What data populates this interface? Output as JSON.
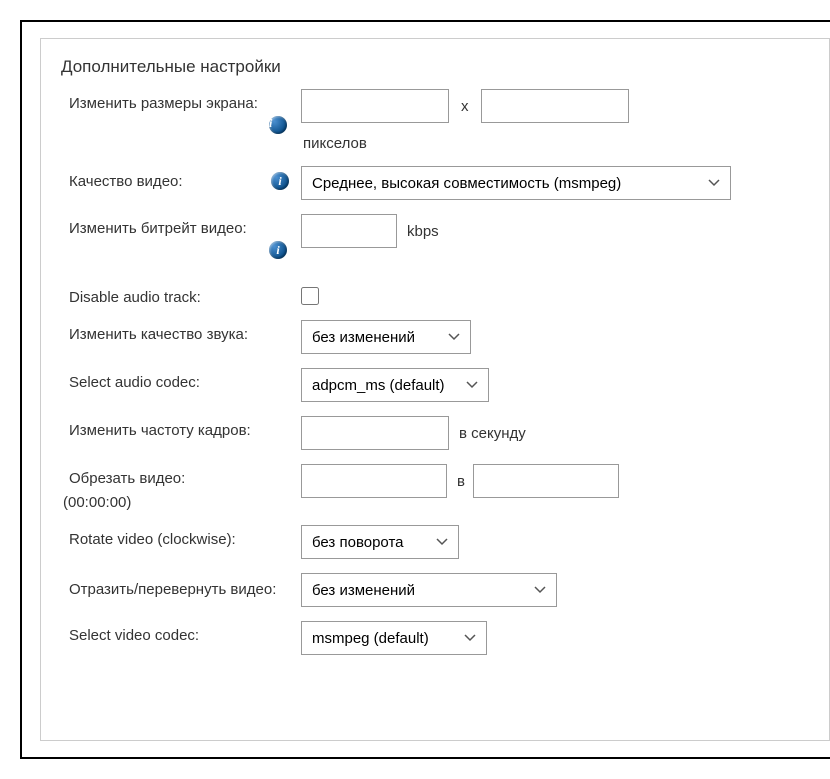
{
  "panel": {
    "title": "Дополнительные настройки"
  },
  "screen_size": {
    "label": "Изменить размеры экрана:",
    "width_value": "",
    "height_value": "",
    "separator": "x",
    "unit": "пикселов"
  },
  "video_quality": {
    "label": "Качество видео:",
    "selected": "Среднее, высокая совместимость (msmpeg)"
  },
  "video_bitrate": {
    "label": "Изменить битрейт видео:",
    "value": "",
    "unit": "kbps"
  },
  "disable_audio": {
    "label": "Disable audio track:",
    "checked": false
  },
  "audio_quality": {
    "label": "Изменить качество звука:",
    "selected": "без изменений"
  },
  "audio_codec": {
    "label": "Select audio codec:",
    "selected": "adpcm_ms (default)"
  },
  "frame_rate": {
    "label": "Изменить частоту кадров:",
    "value": "",
    "unit": "в секунду"
  },
  "crop": {
    "label": "Обрезать видео:",
    "from_value": "",
    "to_value": "",
    "separator": "в",
    "hint": "(00:00:00)"
  },
  "rotate": {
    "label": "Rotate video (clockwise):",
    "selected": "без поворота"
  },
  "flip": {
    "label": "Отразить/перевернуть видео:",
    "selected": "без изменений"
  },
  "video_codec": {
    "label": "Select video codec:",
    "selected": "msmpeg (default)"
  },
  "info_glyph": "i"
}
